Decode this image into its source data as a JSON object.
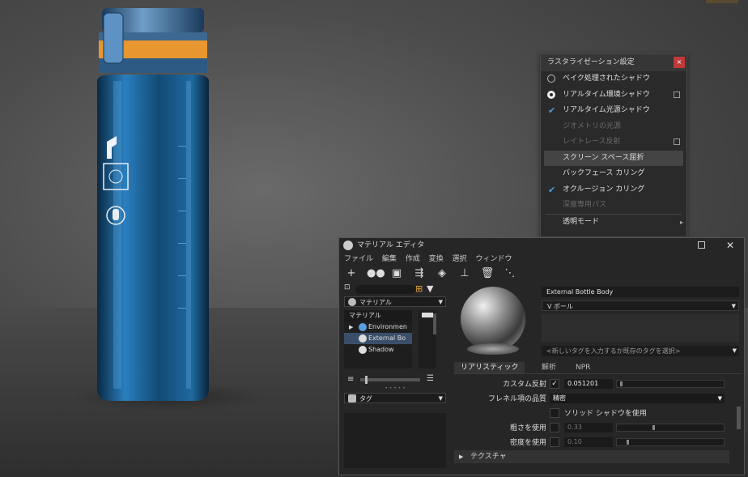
{
  "raster_popup": {
    "title": "ラスタライゼーション設定",
    "close": "×",
    "items": [
      {
        "label": "ベイク処理されたシャドウ",
        "control": "radio-off",
        "state": "enabled"
      },
      {
        "label": "リアルタイム環境シャドウ",
        "control": "radio-on",
        "state": "enabled",
        "has_options": true
      },
      {
        "label": "リアルタイム光源シャドウ",
        "control": "check",
        "state": "enabled"
      },
      {
        "label": "ジオメトリの光源",
        "control": "none",
        "state": "disabled"
      },
      {
        "label": "レイトレース反射",
        "control": "none",
        "state": "disabled",
        "has_options": true
      },
      {
        "label": "スクリーン スペース屈折",
        "control": "none",
        "state": "highlighted"
      },
      {
        "label": "バックフェース カリング",
        "control": "none",
        "state": "enabled"
      },
      {
        "label": "オクルージョン カリング",
        "control": "check",
        "state": "enabled"
      },
      {
        "label": "深度専用パス",
        "control": "none",
        "state": "disabled"
      },
      {
        "label": "透明モード",
        "control": "submenu",
        "state": "enabled"
      }
    ]
  },
  "editor": {
    "title": "マテリアル エディタ",
    "menu": [
      "ファイル",
      "編集",
      "作成",
      "変換",
      "選択",
      "ウィンドウ"
    ],
    "toolbar_icons": [
      "add-icon",
      "link-icon",
      "material-icon",
      "transfer-icon",
      "apply-icon",
      "clean-icon",
      "delete-icon",
      "connect-icon"
    ],
    "left": {
      "search_placeholder": "",
      "library_dropdown": "マテリアル",
      "tree_header": "マテリアル",
      "tree_items": [
        {
          "label": "Environmen",
          "expand": "▶",
          "selected": false
        },
        {
          "label": "External Bo",
          "expand": "",
          "selected": true
        },
        {
          "label": "Shadow",
          "expand": "",
          "selected": false
        }
      ],
      "tag_dropdown": "タグ"
    },
    "right": {
      "material_name": "External Bottle Body",
      "material_type": "V ボール",
      "tag_placeholder": "<新しいタグを入力するか既存のタグを選択>",
      "tabs": [
        "リアリスティック",
        "解析",
        "NPR"
      ],
      "active_tab": "リアリスティック",
      "properties": {
        "clearcoat_label": "カスタム反射",
        "clearcoat_checked": "✓",
        "clearcoat_value": "0.051201",
        "fresnel_label": "フレネル項の品質",
        "fresnel_value": "精密",
        "solid_shadow_label": "ソリッド シャドウを使用",
        "roughness_label": "粗さを使用",
        "roughness_value": "0.33",
        "density_label": "密度を使用",
        "density_value": "0.10"
      },
      "texture_section": "テクスチャ"
    }
  },
  "colors": {
    "accent_check": "#4a9fe0",
    "close_button": "#c0393b",
    "bottle_cap_orange": "#e8962f",
    "bottle_blue": "#1d5f8e"
  }
}
